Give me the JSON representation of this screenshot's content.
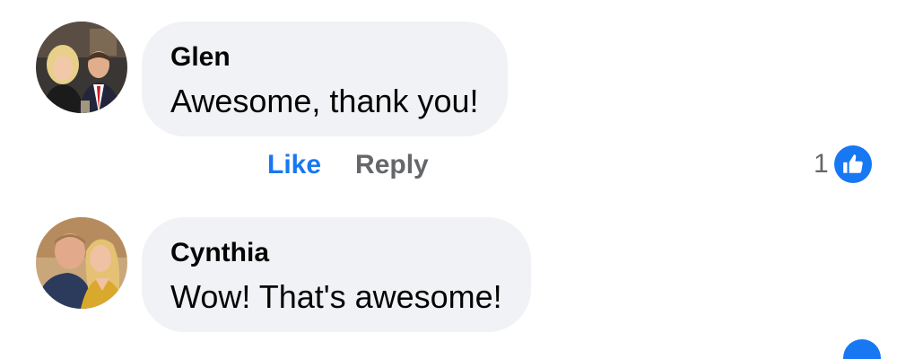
{
  "comments": [
    {
      "author": "Glen",
      "text": "Awesome, thank you!",
      "like_label": "Like",
      "reply_label": "Reply",
      "reaction_count": "1",
      "reaction_icon": "thumbs-up-icon",
      "liked": true
    },
    {
      "author": "Cynthia",
      "text": "Wow! That's awesome!"
    }
  ],
  "colors": {
    "accent": "#1877f2",
    "bubble": "#f0f2f5",
    "muted": "#65676b",
    "text": "#050505"
  }
}
